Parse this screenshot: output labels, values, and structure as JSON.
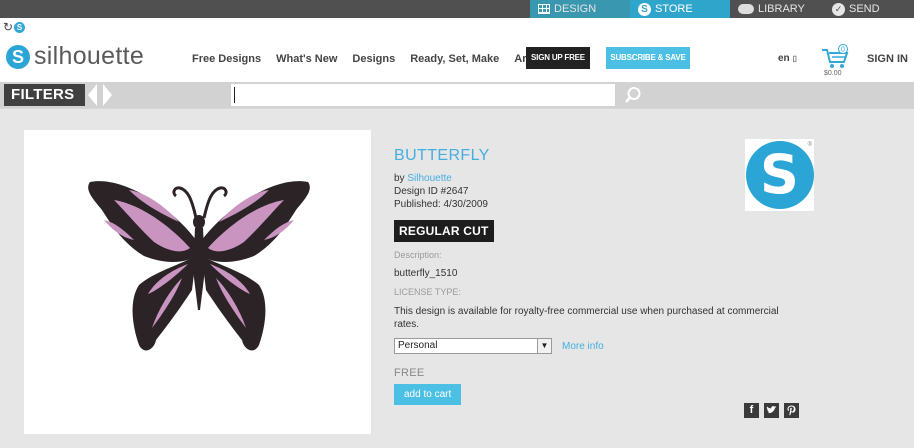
{
  "topnav": {
    "tabs": [
      {
        "label": "DESIGN",
        "icon": "grid-icon"
      },
      {
        "label": "STORE",
        "icon": "silhouette-s-icon"
      },
      {
        "label": "LIBRARY",
        "icon": "cloud-icon"
      },
      {
        "label": "SEND",
        "icon": "check-circle-icon"
      }
    ]
  },
  "header": {
    "logo_text": "silhouette",
    "logo_letter": "S",
    "nav": [
      "Free Designs",
      "What's New",
      "Designs",
      "Ready, Set, Make",
      "Artists"
    ],
    "signup_label": "SIGN UP FREE",
    "subscribe_label": "SUBSCRIBE & SAVE",
    "lang": "en",
    "cart_total": "$0.00",
    "cart_count": "0",
    "signin_label": "SIGN IN"
  },
  "filterbar": {
    "filters_label": "FILTERS",
    "search_value": ""
  },
  "design": {
    "title": "BUTTERFLY",
    "by_prefix": "by ",
    "author": "Silhouette",
    "design_id": "Design ID #2647",
    "published": "Published: 4/30/2009",
    "cut_type": "REGULAR CUT",
    "description_label": "Description:",
    "description": "butterfly_1510",
    "license_label": "LICENSE TYPE:",
    "license_text": "This design is available for royalty-free commercial use when purchased at commercial rates.",
    "license_option": "Personal",
    "more_info": "More info",
    "price": "FREE",
    "add_to_cart": "add to cart",
    "brand_letter": "S",
    "brand_reg": "®"
  },
  "social": {
    "facebook": "f",
    "twitter": "t",
    "pinterest": "p"
  },
  "colors": {
    "accent": "#2fa5cc",
    "link": "#45aee0",
    "dark": "#1d1d1d",
    "butterfly_body": "#2b2326",
    "butterfly_pink": "#c994c0"
  }
}
